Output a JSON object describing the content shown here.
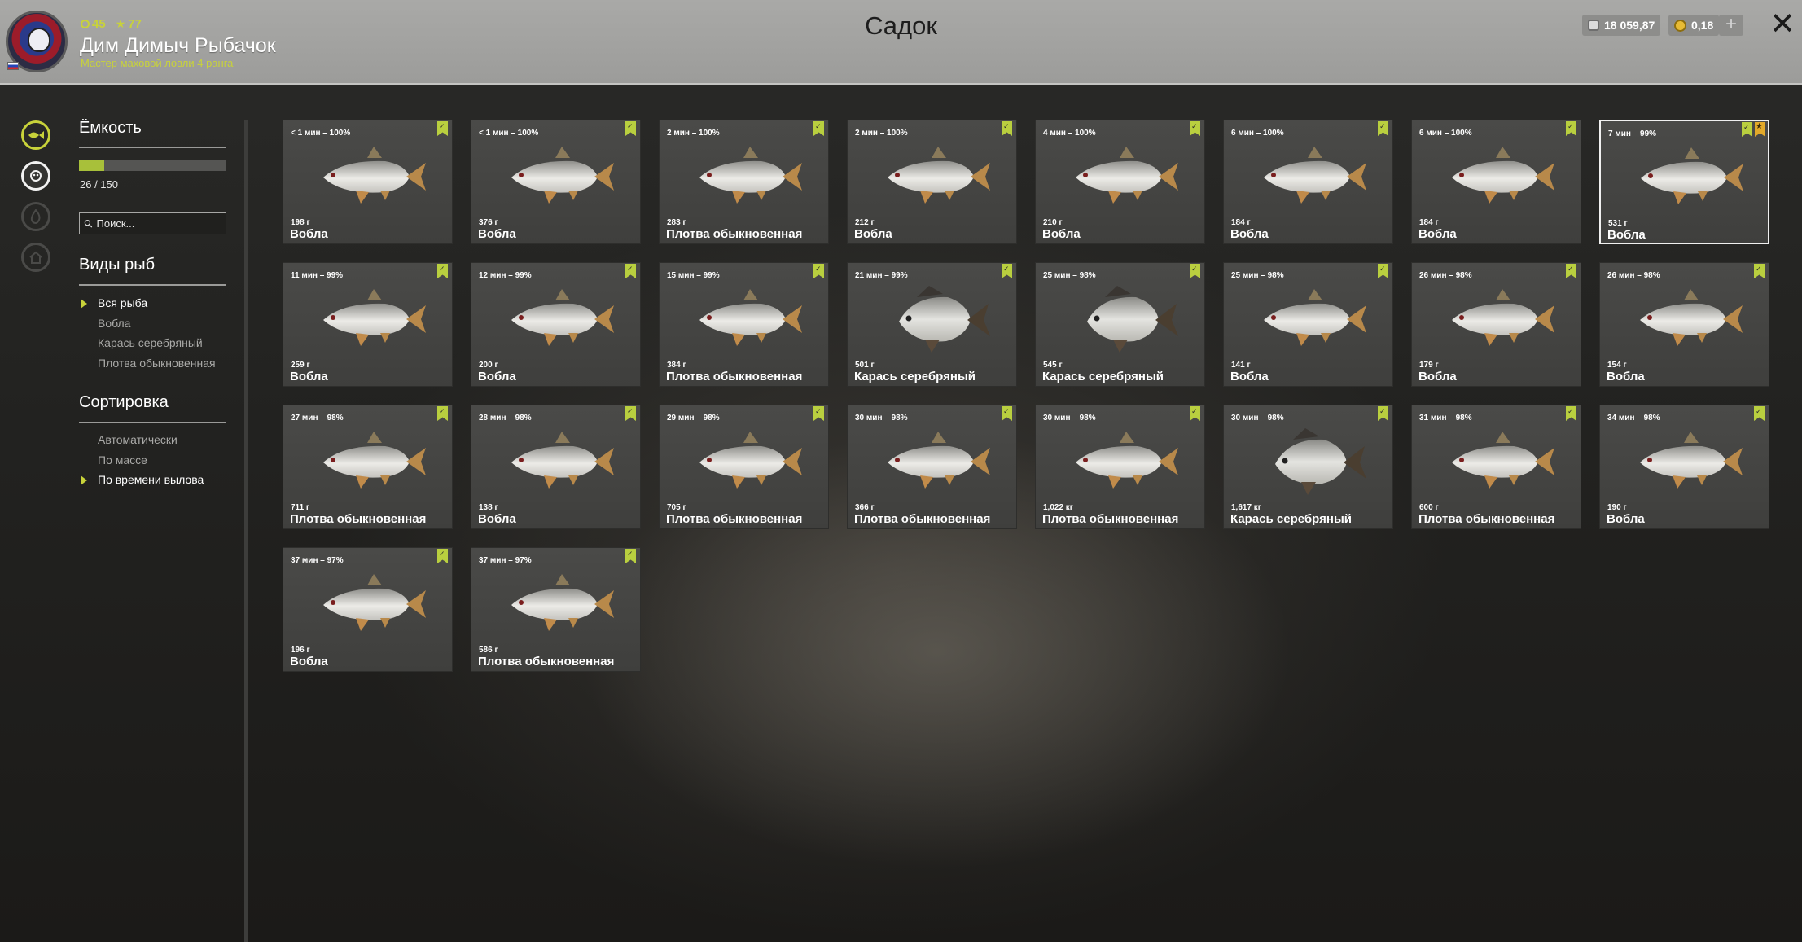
{
  "header": {
    "title": "Садок",
    "player": {
      "level": "45",
      "stars": "77",
      "name": "Дим Димыч Рыбачок",
      "rank": "Мастер маховой ловли 4 ранга"
    },
    "silver": "18 059,87",
    "gold": "0,18",
    "add_label": "+",
    "close_label": "✕"
  },
  "rail": [
    "keepnet-icon",
    "fish-icon",
    "fire-icon",
    "house-icon"
  ],
  "sidebar": {
    "capacity_title": "Ёмкость",
    "capacity_text": "26 / 150",
    "capacity_fraction": 0.173,
    "search_placeholder": "Поиск...",
    "species_title": "Виды рыб",
    "species": [
      {
        "label": "Вся рыба",
        "selected": true
      },
      {
        "label": "Вобла",
        "selected": false
      },
      {
        "label": "Карась серебряный",
        "selected": false
      },
      {
        "label": "Плотва обыкновенная",
        "selected": false
      }
    ],
    "sort_title": "Сортировка",
    "sort": [
      {
        "label": "Автоматически",
        "selected": false
      },
      {
        "label": "По массе",
        "selected": false
      },
      {
        "label": "По времени вылова",
        "selected": true
      }
    ]
  },
  "fish": [
    {
      "time": "< 1 мин – 100%",
      "weight": "198 г",
      "name": "Вобла",
      "kind": "roach"
    },
    {
      "time": "< 1 мин – 100%",
      "weight": "376 г",
      "name": "Вобла",
      "kind": "roach"
    },
    {
      "time": "2 мин – 100%",
      "weight": "283 г",
      "name": "Плотва обыкновенная",
      "kind": "roach"
    },
    {
      "time": "2 мин – 100%",
      "weight": "212 г",
      "name": "Вобла",
      "kind": "roach"
    },
    {
      "time": "4 мин – 100%",
      "weight": "210 г",
      "name": "Вобла",
      "kind": "roach"
    },
    {
      "time": "6 мин – 100%",
      "weight": "184 г",
      "name": "Вобла",
      "kind": "roach"
    },
    {
      "time": "6 мин – 100%",
      "weight": "184 г",
      "name": "Вобла",
      "kind": "roach"
    },
    {
      "time": "7 мин – 99%",
      "weight": "531 г",
      "name": "Вобла",
      "kind": "roach",
      "selected": true,
      "starred": true
    },
    {
      "time": "11 мин – 99%",
      "weight": "259 г",
      "name": "Вобла",
      "kind": "roach"
    },
    {
      "time": "12 мин – 99%",
      "weight": "200 г",
      "name": "Вобла",
      "kind": "roach"
    },
    {
      "time": "15 мин – 99%",
      "weight": "384 г",
      "name": "Плотва обыкновенная",
      "kind": "roach"
    },
    {
      "time": "21 мин – 99%",
      "weight": "501 г",
      "name": "Карась серебряный",
      "kind": "carp"
    },
    {
      "time": "25 мин – 98%",
      "weight": "545 г",
      "name": "Карась серебряный",
      "kind": "carp"
    },
    {
      "time": "25 мин – 98%",
      "weight": "141 г",
      "name": "Вобла",
      "kind": "roach"
    },
    {
      "time": "26 мин – 98%",
      "weight": "179 г",
      "name": "Вобла",
      "kind": "roach"
    },
    {
      "time": "26 мин – 98%",
      "weight": "154 г",
      "name": "Вобла",
      "kind": "roach"
    },
    {
      "time": "27 мин – 98%",
      "weight": "711 г",
      "name": "Плотва обыкновенная",
      "kind": "roach"
    },
    {
      "time": "28 мин – 98%",
      "weight": "138 г",
      "name": "Вобла",
      "kind": "roach"
    },
    {
      "time": "29 мин – 98%",
      "weight": "705 г",
      "name": "Плотва обыкновенная",
      "kind": "roach"
    },
    {
      "time": "30 мин – 98%",
      "weight": "366 г",
      "name": "Плотва обыкновенная",
      "kind": "roach"
    },
    {
      "time": "30 мин – 98%",
      "weight": "1,022 кг",
      "name": "Плотва обыкновенная",
      "kind": "roach"
    },
    {
      "time": "30 мин – 98%",
      "weight": "1,617 кг",
      "name": "Карась серебряный",
      "kind": "carp"
    },
    {
      "time": "31 мин – 98%",
      "weight": "600 г",
      "name": "Плотва обыкновенная",
      "kind": "roach"
    },
    {
      "time": "34 мин – 98%",
      "weight": "190 г",
      "name": "Вобла",
      "kind": "roach"
    },
    {
      "time": "37 мин – 97%",
      "weight": "196 г",
      "name": "Вобла",
      "kind": "roach"
    },
    {
      "time": "37 мин – 97%",
      "weight": "586 г",
      "name": "Плотва обыкновенная",
      "kind": "roach"
    }
  ],
  "colors": {
    "accent": "#c8d23a",
    "bookmark": "#b9cf3f",
    "header_bg": "#a9a9a7",
    "card_bg": "#454543"
  }
}
